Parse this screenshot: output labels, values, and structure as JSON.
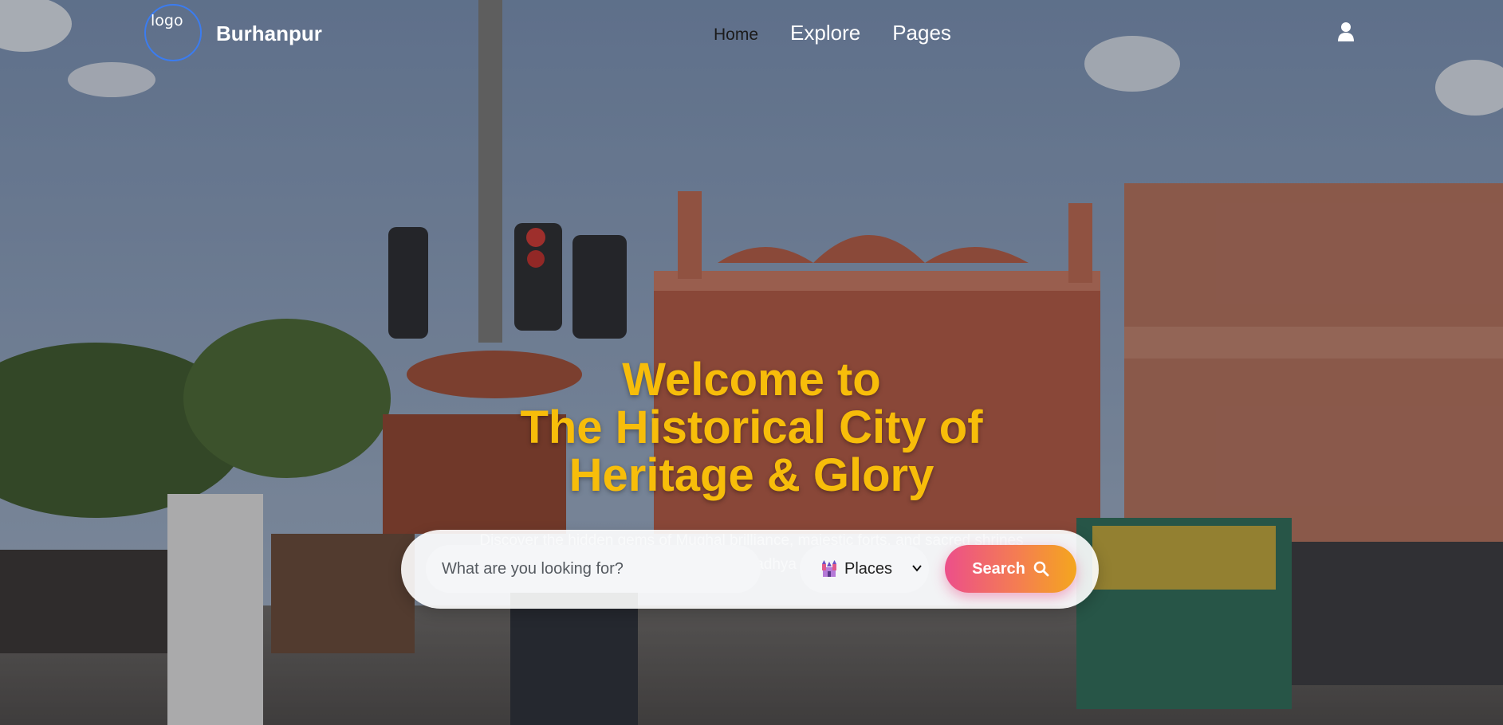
{
  "navbar": {
    "logo_alt": "logo",
    "brand": "Burhanpur",
    "links": [
      {
        "label": "Home",
        "active": true
      },
      {
        "label": "Explore",
        "active": false
      },
      {
        "label": "Pages",
        "active": false
      }
    ],
    "user_icon": "user-icon"
  },
  "hero": {
    "title_lines": [
      "Welcome to",
      "The Historical City of",
      "Heritage & Glory"
    ],
    "subtitle_lines": [
      "Discover the hidden gems of Mughal brilliance, majestic forts, and sacred shrines",
      "in the heart of Madhya Pradesh"
    ],
    "title_color": "#f7bd0a"
  },
  "search": {
    "placeholder": "What are you looking for?",
    "category": {
      "icon": "castle-icon",
      "selected": "Places"
    },
    "button_label": "Search",
    "button_icon": "search-icon"
  }
}
